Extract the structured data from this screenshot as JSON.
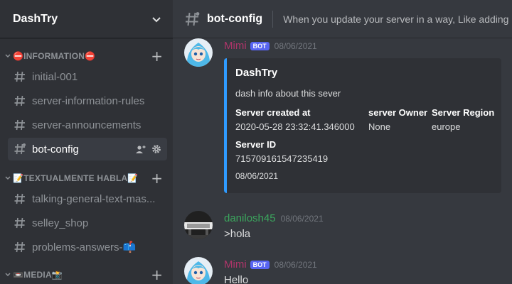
{
  "server": {
    "name": "DashTry"
  },
  "sidebar": {
    "categories": [
      {
        "label": "⛔INFORMATION⛔",
        "channels": [
          {
            "name": "initial-001"
          },
          {
            "name": "server-information-rules"
          },
          {
            "name": "server-announcements"
          },
          {
            "name": "bot-config",
            "active": true
          }
        ]
      },
      {
        "label": "📝TEXTUALMENTE HABLA📝",
        "channels": [
          {
            "name": "talking-general-text-mas..."
          },
          {
            "name": "selley_shop"
          },
          {
            "name": "problems-answers-📫"
          }
        ]
      },
      {
        "label": "📼MEDIA📸"
      }
    ]
  },
  "header": {
    "channel": "bot-config",
    "topic": "When you update your server in a way, Like adding a r"
  },
  "messages": [
    {
      "author": "Mimi",
      "author_color": "#b0356a",
      "bot_tag": "BOT",
      "timestamp": "08/06/2021",
      "embed": {
        "accent": "#2f9bff",
        "title": "DashTry",
        "description": "dash info about this sever",
        "fields": [
          {
            "name": "Server created at",
            "value": "2020-05-28 23:32:41.346000"
          },
          {
            "name": "server Owner",
            "value": "None"
          },
          {
            "name": "Server Region",
            "value": "europe"
          },
          {
            "name": "Server ID",
            "value": "715709161547235419"
          }
        ],
        "footer": "08/06/2021"
      }
    },
    {
      "author": "danilosh45",
      "author_color": "#3ba55d",
      "timestamp": "08/06/2021",
      "text": ">hola"
    },
    {
      "author": "Mimi",
      "author_color": "#b0356a",
      "bot_tag": "BOT",
      "timestamp": "08/06/2021",
      "text": "Hello"
    }
  ]
}
